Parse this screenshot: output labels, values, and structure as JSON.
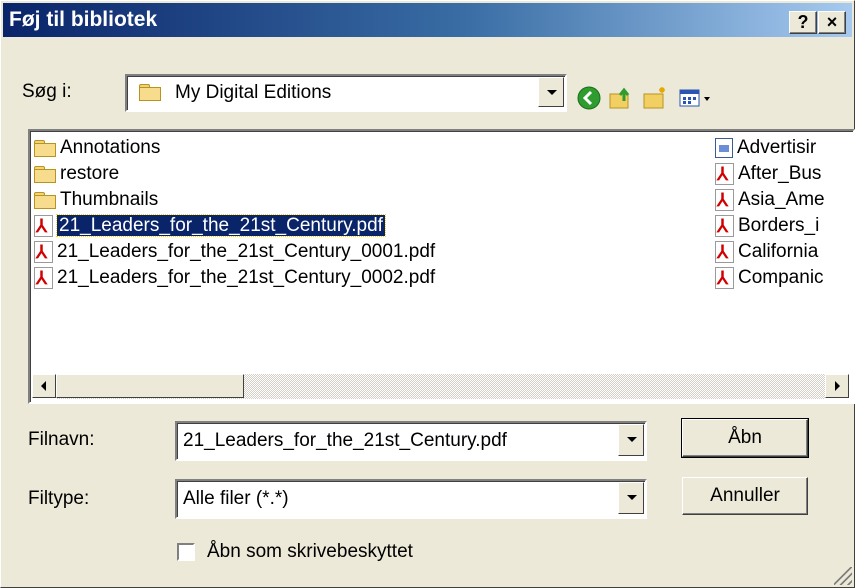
{
  "window": {
    "title": "Føj til bibliotek",
    "help_button": "?",
    "close_button": "×"
  },
  "lookin": {
    "label": "Søg i:",
    "value": "My Digital Editions",
    "toolbar": {
      "back_icon": "back-arrow-icon",
      "up_icon": "up-folder-icon",
      "newfolder_icon": "new-folder-icon",
      "views_icon": "views-menu-icon"
    }
  },
  "files": {
    "left_column": [
      {
        "name": "Annotations",
        "type": "folder"
      },
      {
        "name": "restore",
        "type": "folder"
      },
      {
        "name": "Thumbnails",
        "type": "folder"
      },
      {
        "name": "21_Leaders_for_the_21st_Century.pdf",
        "type": "pdf",
        "selected": true
      },
      {
        "name": "21_Leaders_for_the_21st_Century_0001.pdf",
        "type": "pdf"
      },
      {
        "name": "21_Leaders_for_the_21st_Century_0002.pdf",
        "type": "pdf"
      }
    ],
    "right_column": [
      {
        "name": "Advertisir",
        "type": "doc"
      },
      {
        "name": "After_Bus",
        "type": "pdf"
      },
      {
        "name": "Asia_Ame",
        "type": "pdf"
      },
      {
        "name": "Borders_i",
        "type": "pdf"
      },
      {
        "name": "California",
        "type": "pdf"
      },
      {
        "name": "Companic",
        "type": "pdf"
      }
    ]
  },
  "filename": {
    "label": "Filnavn:",
    "value": "21_Leaders_for_the_21st_Century.pdf"
  },
  "filetype": {
    "label": "Filtype:",
    "value": "Alle filer (*.*)"
  },
  "buttons": {
    "open": "Åbn",
    "cancel": "Annuller"
  },
  "readonly": {
    "label": "Åbn som skrivebeskyttet",
    "checked": false
  }
}
